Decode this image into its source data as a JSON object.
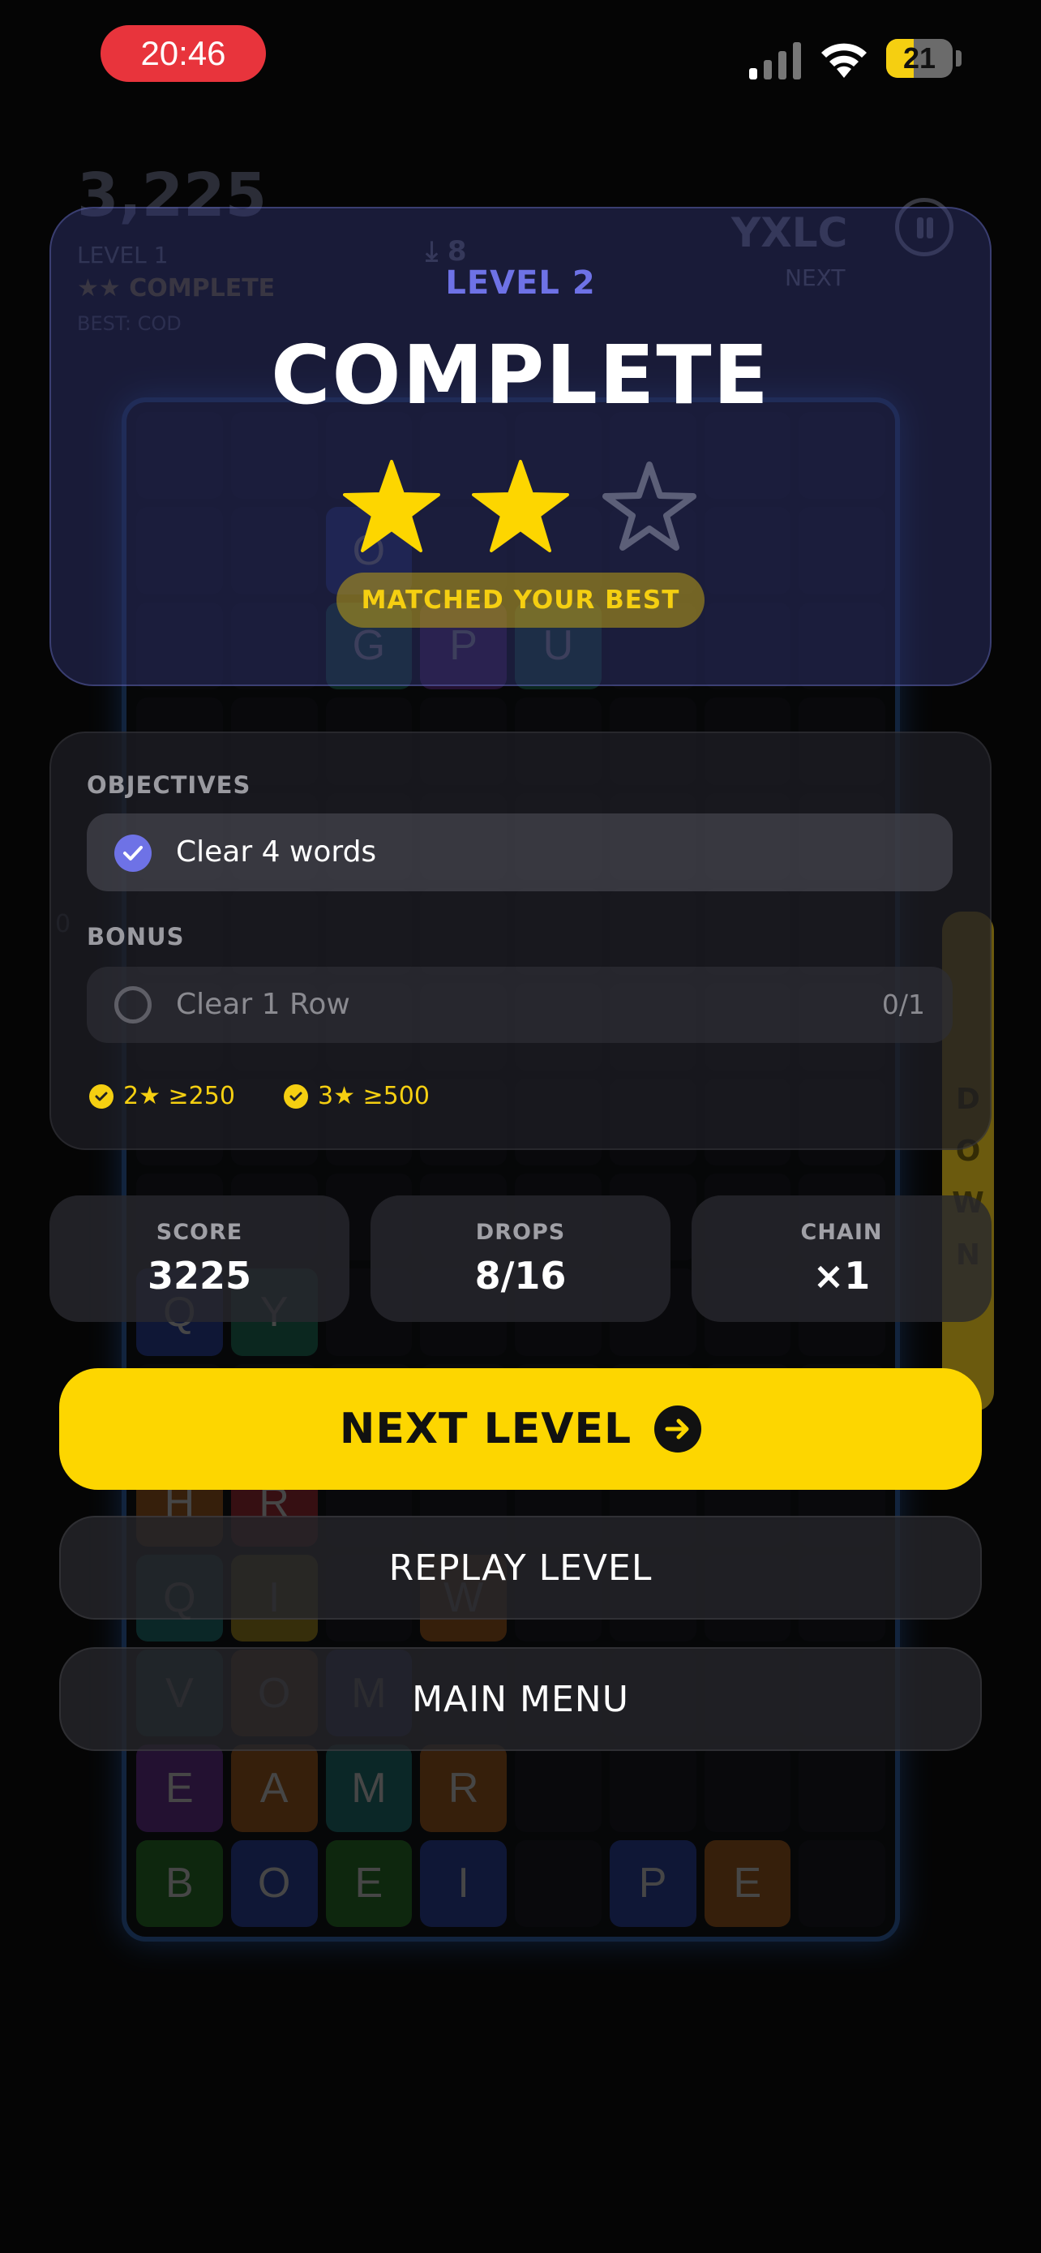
{
  "status_bar": {
    "time": "20:46",
    "battery": "21",
    "battery_level": 0.42
  },
  "background_game": {
    "score": "3,225",
    "level": "LEVEL 1",
    "stars_text": "★★ COMPLETE",
    "best": "BEST: COD",
    "drops": "⤓ 8",
    "next_word": "YXLC",
    "next_label": "NEXT",
    "side_counter": "0",
    "down_label": [
      "D",
      "O",
      "W",
      "N"
    ],
    "tiles": [
      {
        "letter": "O",
        "row": 1,
        "col": 2,
        "color": "#2c4cc4"
      },
      {
        "letter": "G",
        "row": 2,
        "col": 2,
        "color": "#1f8a6a"
      },
      {
        "letter": "P",
        "row": 2,
        "col": 3,
        "color": "#7a34b0"
      },
      {
        "letter": "U",
        "row": 2,
        "col": 4,
        "color": "#1f8a6a"
      },
      {
        "letter": "Q",
        "row": 9,
        "col": 0,
        "color": "#2c4cc4"
      },
      {
        "letter": "Y",
        "row": 9,
        "col": 1,
        "color": "#1f8a6a"
      },
      {
        "letter": "H",
        "row": 11,
        "col": 0,
        "color": "#c46a1f"
      },
      {
        "letter": "R",
        "row": 11,
        "col": 1,
        "color": "#c42c3a"
      },
      {
        "letter": "Q",
        "row": 12,
        "col": 0,
        "color": "#1f8a8a"
      },
      {
        "letter": "I",
        "row": 12,
        "col": 1,
        "color": "#c4a41f"
      },
      {
        "letter": "W",
        "row": 12,
        "col": 3,
        "color": "#c46a1f"
      },
      {
        "letter": "V",
        "row": 13,
        "col": 0,
        "color": "#1f8a8a"
      },
      {
        "letter": "O",
        "row": 13,
        "col": 1,
        "color": "#c46a1f"
      },
      {
        "letter": "M",
        "row": 13,
        "col": 2,
        "color": "#2c4cc4"
      },
      {
        "letter": "E",
        "row": 14,
        "col": 0,
        "color": "#7a34b0"
      },
      {
        "letter": "A",
        "row": 14,
        "col": 1,
        "color": "#c46a1f"
      },
      {
        "letter": "M",
        "row": 14,
        "col": 2,
        "color": "#1f8a8a"
      },
      {
        "letter": "R",
        "row": 14,
        "col": 3,
        "color": "#c46a1f"
      },
      {
        "letter": "B",
        "row": 15,
        "col": 0,
        "color": "#2a8a2a"
      },
      {
        "letter": "O",
        "row": 15,
        "col": 1,
        "color": "#2c4cc4"
      },
      {
        "letter": "E",
        "row": 15,
        "col": 2,
        "color": "#2a8a2a"
      },
      {
        "letter": "I",
        "row": 15,
        "col": 3,
        "color": "#2c4cc4"
      },
      {
        "letter": "P",
        "row": 15,
        "col": 5,
        "color": "#2c4cc4"
      },
      {
        "letter": "E",
        "row": 15,
        "col": 6,
        "color": "#c46a1f"
      }
    ]
  },
  "modal": {
    "level_label": "LEVEL 2",
    "title": "COMPLETE",
    "stars_earned": 2,
    "stars_total": 3,
    "best_badge": "MATCHED YOUR BEST",
    "objectives_label": "OBJECTIVES",
    "objective": {
      "text": "Clear 4 words",
      "done": true
    },
    "bonus_label": "BONUS",
    "bonus": {
      "text": "Clear 1 Row",
      "progress": "0/1",
      "done": false
    },
    "thresholds": [
      "2★ ≥250",
      "3★ ≥500"
    ],
    "stats": [
      {
        "label": "SCORE",
        "value": "3225"
      },
      {
        "label": "DROPS",
        "value": "8/16"
      },
      {
        "label": "CHAIN",
        "value": "×1"
      }
    ],
    "next_button": "NEXT LEVEL",
    "replay_button": "REPLAY LEVEL",
    "menu_button": "MAIN MENU"
  },
  "colors": {
    "accent": "#6e72e6",
    "gold": "#fdd600",
    "danger": "#e8343c"
  }
}
